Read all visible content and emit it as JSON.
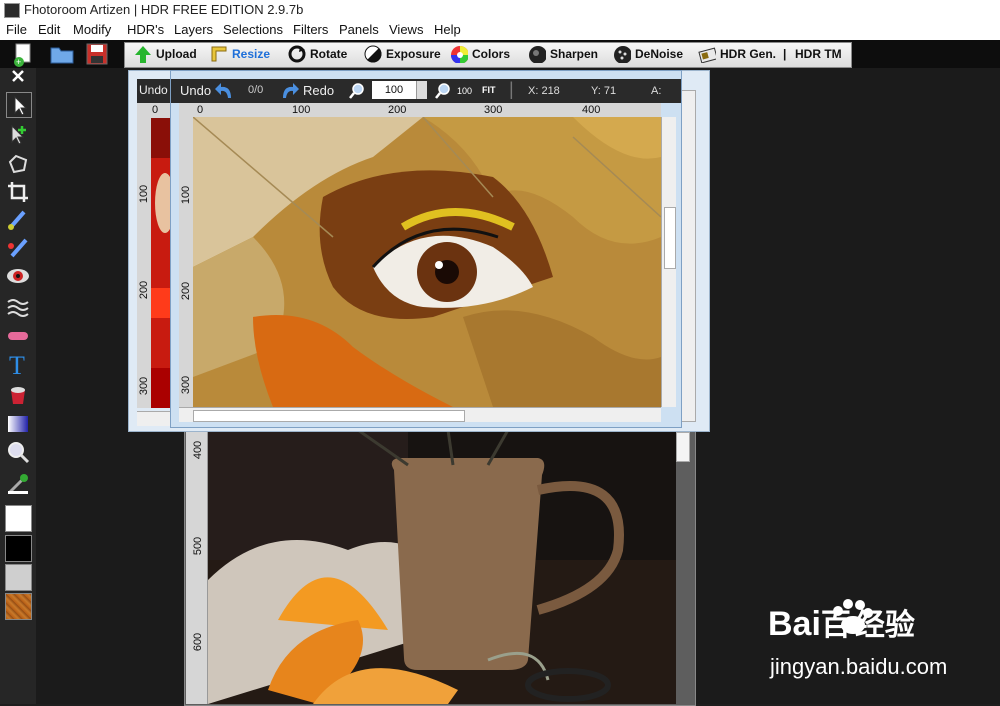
{
  "title": "Fhotoroom Artizen | HDR FREE EDITION 2.9.7b",
  "menu": [
    "File",
    "Edit",
    "Modify",
    "HDR's",
    "Layers",
    "Selections",
    "Filters",
    "Panels",
    "Views",
    "Help"
  ],
  "toolbar": {
    "tools": [
      "Upload",
      "Resize",
      "Rotate",
      "Exposure",
      "Colors",
      "Sharpen",
      "DeNoise",
      "HDR Gen.",
      "|",
      "HDR TM"
    ]
  },
  "front_window": {
    "undo": "Undo",
    "history": "0/0",
    "redo": "Redo",
    "zoom_value": "100",
    "zoom_100": "100",
    "fit": "FIT",
    "x_label": "X: 218",
    "y_label": "Y: 71",
    "a_label": "A:",
    "ruler_h": [
      "0",
      "100",
      "200",
      "300",
      "400"
    ],
    "ruler_v": [
      "100",
      "200",
      "300"
    ]
  },
  "mid_window": {
    "undo": "Undo",
    "ruler_top": "0",
    "ruler_v": [
      "100",
      "200",
      "300"
    ]
  },
  "back_window": {
    "ruler_v": [
      "400",
      "500",
      "600"
    ]
  },
  "watermark": {
    "brand": "Bai",
    "brand2": "百",
    "brand_cn": "经验",
    "url": "jingyan.baidu.com"
  },
  "colors": {
    "accent_resize": "#1e6fd9",
    "window_frame": "#8fb0d2"
  }
}
